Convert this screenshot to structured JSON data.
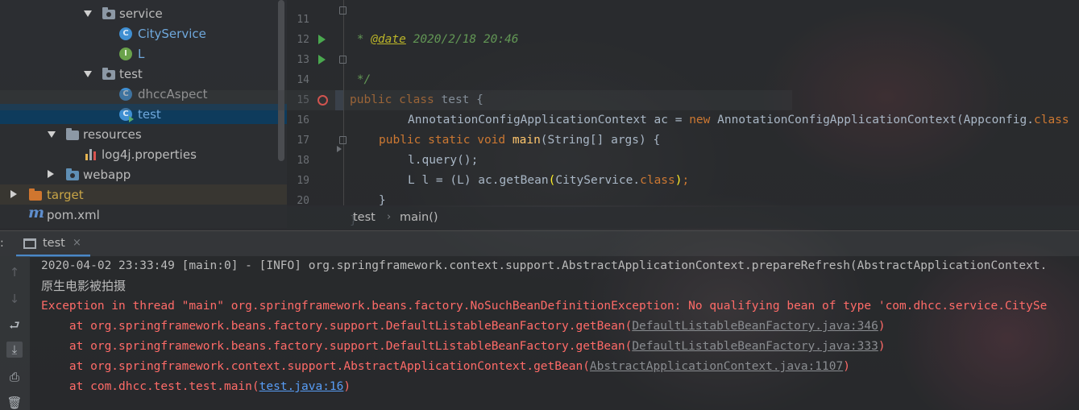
{
  "colors": {
    "accent": "#4a88c7",
    "selection": "#0e3b5c",
    "error_text": "#ff6b68",
    "keyword": "#cc7832",
    "method": "#ffc66d",
    "comment": "#629755",
    "link": "#589df6"
  },
  "project_tree": {
    "items": [
      {
        "label": "service",
        "icon": "package-folder-icon"
      },
      {
        "label": "CityService",
        "icon": "class-icon"
      },
      {
        "label": "L",
        "icon": "interface-icon"
      },
      {
        "label": "test",
        "icon": "package-folder-icon"
      },
      {
        "label": "dhccAspect",
        "icon": "class-icon"
      },
      {
        "label": "test",
        "icon": "runnable-class-icon"
      },
      {
        "label": "resources",
        "icon": "resources-folder-icon"
      },
      {
        "label": "log4j.properties",
        "icon": "properties-file-icon"
      },
      {
        "label": "webapp",
        "icon": "web-folder-icon"
      },
      {
        "label": "target",
        "icon": "excluded-folder-icon"
      },
      {
        "label": "pom.xml",
        "icon": "maven-icon"
      }
    ]
  },
  "editor": {
    "line_numbers": [
      "11",
      "12",
      "13",
      "14",
      "15",
      "16",
      "17",
      "18",
      "19",
      "20"
    ],
    "lines": {
      "l11_ann": "@date",
      "l11_rest": " 2020/2/18 20:46",
      "l12": " */",
      "l13_kw": "public class",
      "l13_rest": " test {",
      "l14_kw": "public static void",
      "l14_fn": "main",
      "l14_rest": "(String[] args) {",
      "l15_a": "AnnotationConfigApplicationContext ac = ",
      "l15_kw": "new",
      "l15_b": " AnnotationConfigApplicationContext(Appconfig.",
      "l15_kw2": "class",
      "l16_a": "L l = (L) ac.getBean",
      "l16_p1": "(",
      "l16_b": "CityService.",
      "l16_kw": "class",
      "l16_p2": ")",
      "l16_c": ";",
      "l17": "l.query();",
      "l18": "}",
      "l19": "}"
    }
  },
  "breadcrumb": {
    "items": [
      "test",
      "main()"
    ]
  },
  "run_panel": {
    "tab_label": "test",
    "close_glyph": "×",
    "console": {
      "info_line": "2020-04-02 23:33:49 [main:0] - [INFO] org.springframework.context.support.AbstractApplicationContext.prepareRefresh(AbstractApplicationContext.",
      "output_line": "原生电影被拍摄",
      "exception_line": "Exception in thread \"main\" org.springframework.beans.factory.NoSuchBeanDefinitionException: No qualifying bean of type 'com.dhcc.service.CitySe",
      "stack": [
        {
          "prefix": "    at org.springframework.beans.factory.support.DefaultListableBeanFactory.getBean(",
          "link": "DefaultListableBeanFactory.java:346",
          "suffix": ")",
          "link_style": "gray"
        },
        {
          "prefix": "    at org.springframework.beans.factory.support.DefaultListableBeanFactory.getBean(",
          "link": "DefaultListableBeanFactory.java:333",
          "suffix": ")",
          "link_style": "gray"
        },
        {
          "prefix": "    at org.springframework.context.support.AbstractApplicationContext.getBean(",
          "link": "AbstractApplicationContext.java:1107",
          "suffix": ")",
          "link_style": "gray"
        },
        {
          "prefix": "    at com.dhcc.test.test.main(",
          "link": "test.java:16",
          "suffix": ")",
          "link_style": "blue"
        }
      ]
    },
    "toolbar_icons": [
      "up-arrow-icon",
      "down-arrow-icon",
      "soft-wrap-icon",
      "scroll-to-end-icon",
      "print-icon",
      "trash-icon"
    ]
  }
}
